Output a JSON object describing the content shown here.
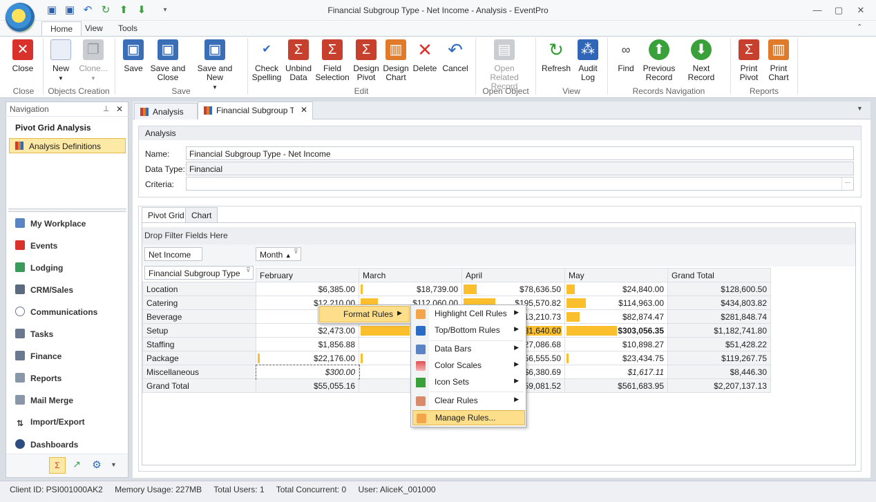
{
  "window": {
    "title": "Financial Subgroup Type - Net Income - Analysis - EventPro"
  },
  "ribbon_tabs": [
    "Home",
    "View",
    "Tools"
  ],
  "ribbon": {
    "close": "Close",
    "new": "New",
    "clone": "Clone...",
    "save": "Save",
    "save_close": [
      "Save and",
      "Close"
    ],
    "save_new": "Save and New",
    "check_spelling": [
      "Check",
      "Spelling"
    ],
    "unbind_data": [
      "Unbind",
      "Data"
    ],
    "field_selection": [
      "Field",
      "Selection"
    ],
    "design_pivot": [
      "Design",
      "Pivot"
    ],
    "design_chart": [
      "Design",
      "Chart"
    ],
    "delete": "Delete",
    "cancel": "Cancel",
    "open_related": [
      "Open Related",
      "Record"
    ],
    "refresh": "Refresh",
    "audit_log": [
      "Audit",
      "Log"
    ],
    "find": "Find",
    "previous_record": [
      "Previous",
      "Record"
    ],
    "next_record": "Next Record",
    "print_pivot": [
      "Print",
      "Pivot"
    ],
    "print_chart": [
      "Print",
      "Chart"
    ],
    "groups": {
      "close": "Close",
      "objects_creation": "Objects Creation",
      "save": "Save",
      "edit": "Edit",
      "open_object": "Open Object",
      "view": "View",
      "records_navigation": "Records Navigation",
      "reports": "Reports"
    }
  },
  "navigation": {
    "header": "Navigation",
    "title": "Pivot Grid Analysis",
    "selected_item": "Analysis Definitions",
    "links": [
      "My Workplace",
      "Events",
      "Lodging",
      "CRM/Sales",
      "Communications",
      "Tasks",
      "Finance",
      "Reports",
      "Mail Merge",
      "Import/Export",
      "Dashboards"
    ]
  },
  "doc_tabs": [
    "Analysis",
    "Financial Subgroup Type"
  ],
  "analysis": {
    "header": "Analysis",
    "name_label": "Name:",
    "name_value": "Financial Subgroup Type - Net Income",
    "data_type_label": "Data Type:",
    "data_type_value": "Financial",
    "criteria_label": "Criteria:",
    "criteria_value": "",
    "ellipsis": "..."
  },
  "pivot_tabs": [
    "Pivot Grid",
    "Chart"
  ],
  "pivot": {
    "filter_zone": "Drop Filter Fields Here",
    "data_field": "Net Income",
    "column_field": "Month",
    "row_field": "Financial Subgroup Type",
    "columns": [
      "February",
      "March",
      "April",
      "May",
      "Grand Total"
    ],
    "rows": [
      {
        "label": "Location",
        "values": [
          "$6,385.00",
          "$18,739.00",
          "$78,636.50",
          "$24,840.00",
          "$128,600.50"
        ],
        "bars": [
          0,
          0.02,
          0.13,
          0.08
        ]
      },
      {
        "label": "Catering",
        "values": [
          "$12,210.00",
          "$112,060.00",
          "$195,570.82",
          "$114,963.00",
          "$434,803.82"
        ],
        "bars": [
          0,
          0.17,
          0.32,
          0.19
        ]
      },
      {
        "label": "Beverage",
        "values": [
          "",
          "",
          "$113,210.73",
          "$82,874.47",
          "$281,848.74"
        ],
        "bars": [
          0,
          0,
          0,
          0.13
        ]
      },
      {
        "label": "Setup",
        "values": [
          "$2,473.00",
          "",
          "$181,640.60",
          "$303,056.35",
          "$1,182,741.80"
        ],
        "bars": [
          0,
          0.49,
          0.98,
          0.5
        ]
      },
      {
        "label": "Staffing",
        "values": [
          "$1,856.88",
          "",
          "$27,086.68",
          "$10,898.27",
          "$51,428.22"
        ],
        "bars": [
          0,
          0,
          0,
          0
        ]
      },
      {
        "label": "Package",
        "values": [
          "$22,176.00",
          "",
          "$56,555.50",
          "$23,434.75",
          "$119,267.75"
        ],
        "bars": [
          0.02,
          0.02,
          0,
          0.02
        ]
      },
      {
        "label": "Miscellaneous",
        "values": [
          "$300.00",
          "",
          "$6,380.69",
          "$1,617.11",
          "$8,446.30"
        ],
        "bars": [
          0,
          0,
          0,
          0
        ]
      }
    ],
    "grand_total": {
      "label": "Grand Total",
      "values": [
        "$55,055.16",
        "",
        "$659,081.52",
        "$561,683.95",
        "$2,207,137.13"
      ]
    }
  },
  "context_menu": {
    "format_rules": "Format Rules",
    "submenu": [
      "Highlight Cell Rules",
      "Top/Bottom Rules",
      "Data Bars",
      "Color Scales",
      "Icon Sets",
      "Clear Rules",
      "Manage Rules..."
    ]
  },
  "status": {
    "client_id": "Client ID: PSI001000AK2",
    "memory": "Memory Usage: 227MB",
    "total_users": "Total Users: 1",
    "total_concurrent": "Total Concurrent: 0",
    "user": "User: AliceK_001000"
  },
  "colors": {
    "accent_bar": "#fbbf2d",
    "menu_highlight": "#fcde8b",
    "close_red": "#d9322c"
  }
}
